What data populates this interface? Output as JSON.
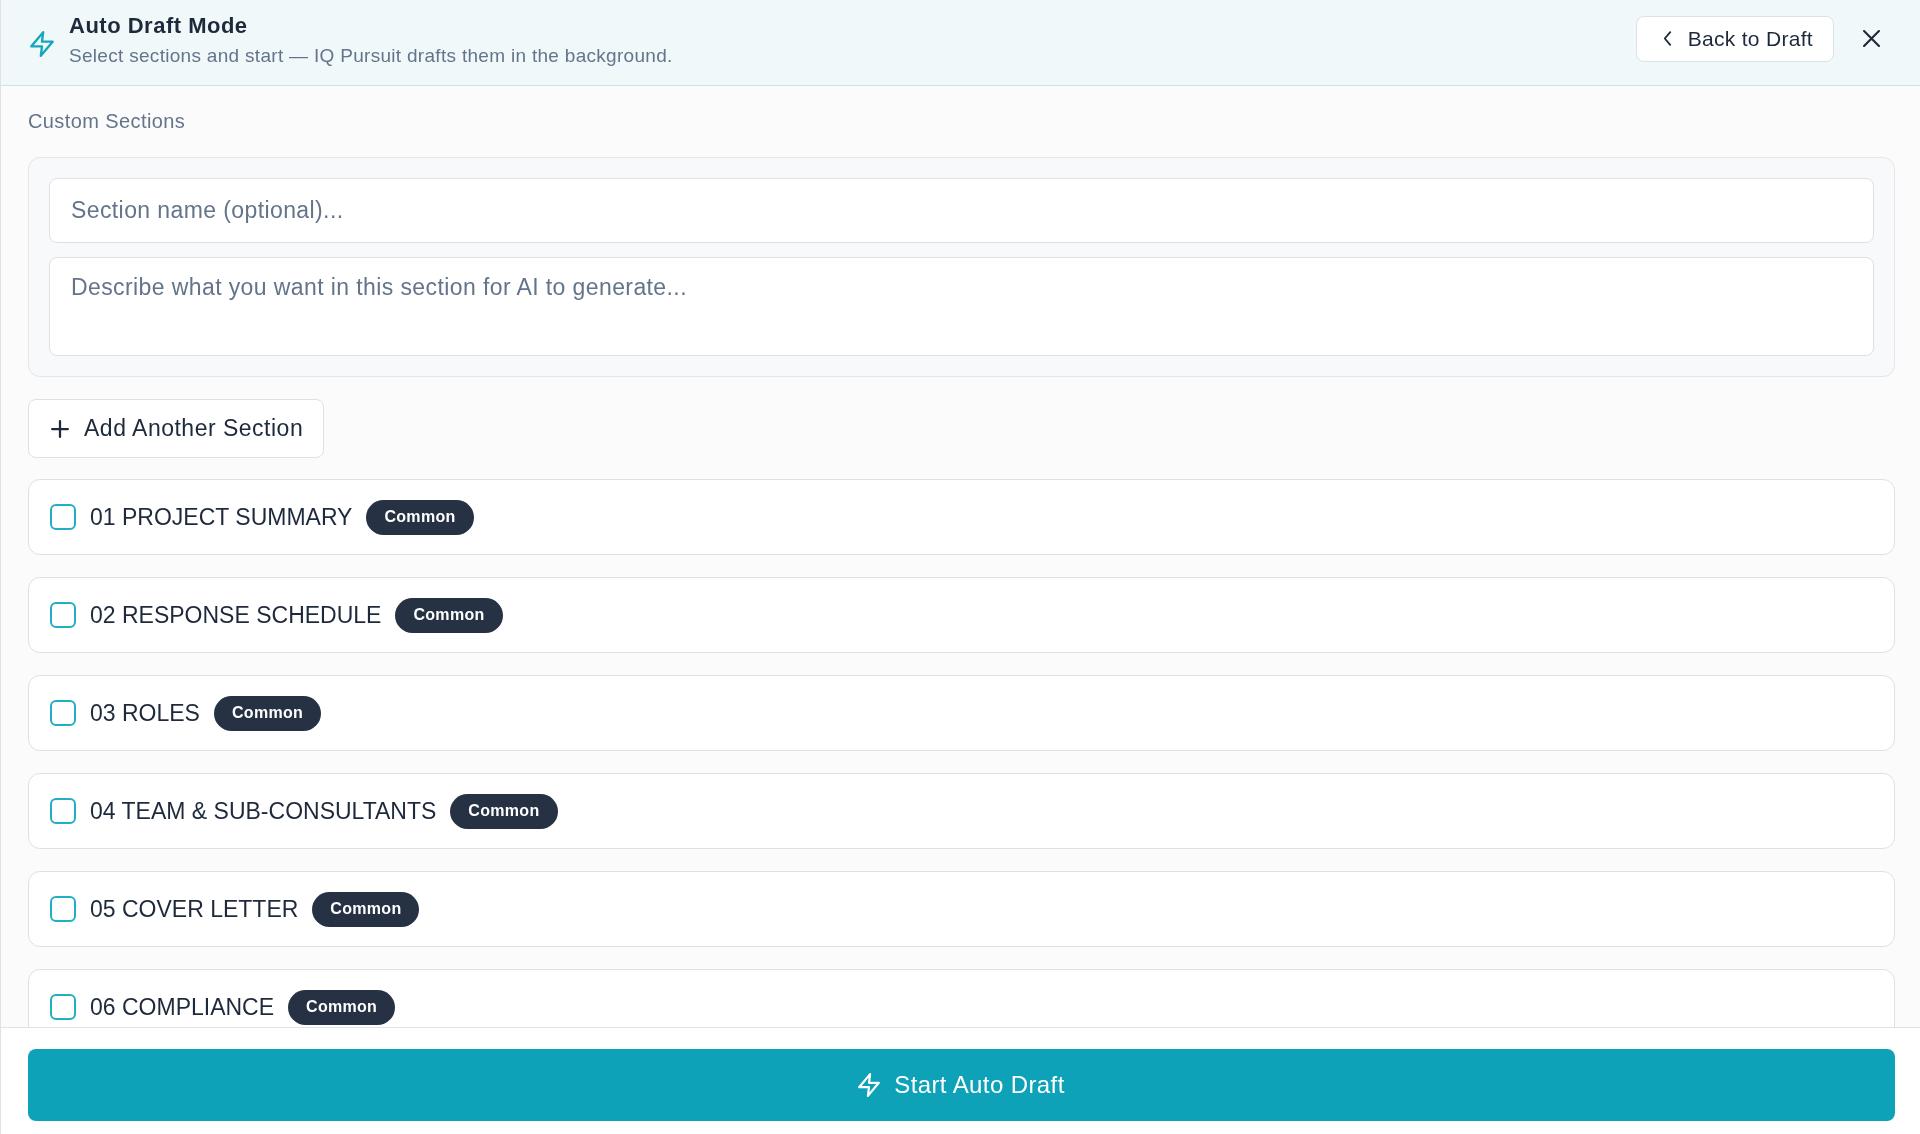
{
  "header": {
    "title": "Auto Draft Mode",
    "subtitle": "Select sections and start — IQ Pursuit drafts them in the background.",
    "back_button": "Back to Draft"
  },
  "custom_sections": {
    "label": "Custom Sections",
    "name_field": {
      "placeholder": "Section name (optional)..."
    },
    "description_field": {
      "placeholder": "Describe what you want in this section for AI to generate..."
    },
    "add_button": "Add Another Section"
  },
  "sections": [
    {
      "label": "01 PROJECT SUMMARY",
      "badge": "Common",
      "checked": false
    },
    {
      "label": "02 RESPONSE SCHEDULE",
      "badge": "Common",
      "checked": false
    },
    {
      "label": "03 ROLES",
      "badge": "Common",
      "checked": false
    },
    {
      "label": "04 TEAM & SUB-CONSULTANTS",
      "badge": "Common",
      "checked": false
    },
    {
      "label": "05 COVER LETTER",
      "badge": "Common",
      "checked": false
    },
    {
      "label": "06 COMPLIANCE",
      "badge": "Common",
      "checked": false
    }
  ],
  "start_button": "Start Auto Draft"
}
